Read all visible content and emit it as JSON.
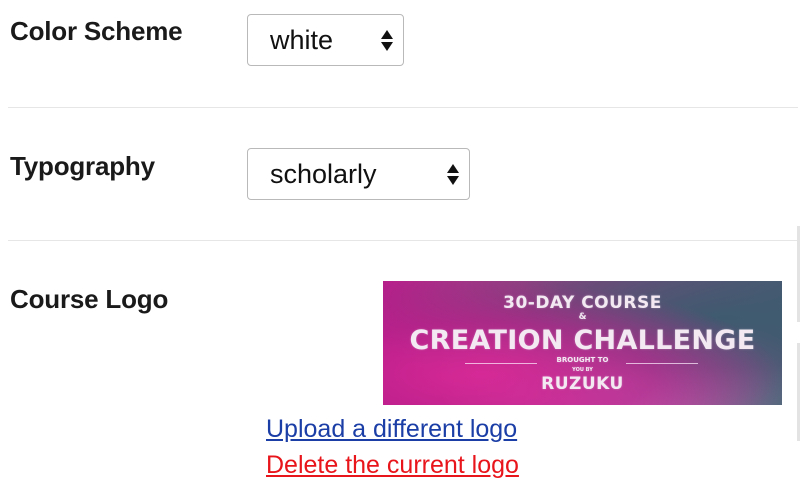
{
  "color_scheme": {
    "label": "Color Scheme",
    "selected": "white"
  },
  "typography": {
    "label": "Typography",
    "selected": "scholarly"
  },
  "course_logo": {
    "label": "Course Logo",
    "image_text": {
      "line1": "30-DAY COURSE",
      "line2": "&",
      "line3": "CREATION CHALLENGE",
      "line4": "BROUGHT TO",
      "line5": "YOU BY",
      "line6": "RUZUKU"
    },
    "upload_link": "Upload a different logo",
    "delete_link": "Delete the current logo"
  },
  "colors": {
    "upload_link": "#1a3da6",
    "delete_link": "#e8151b",
    "logo_magenta": "#c2338f",
    "logo_slate": "#4a6a78"
  }
}
